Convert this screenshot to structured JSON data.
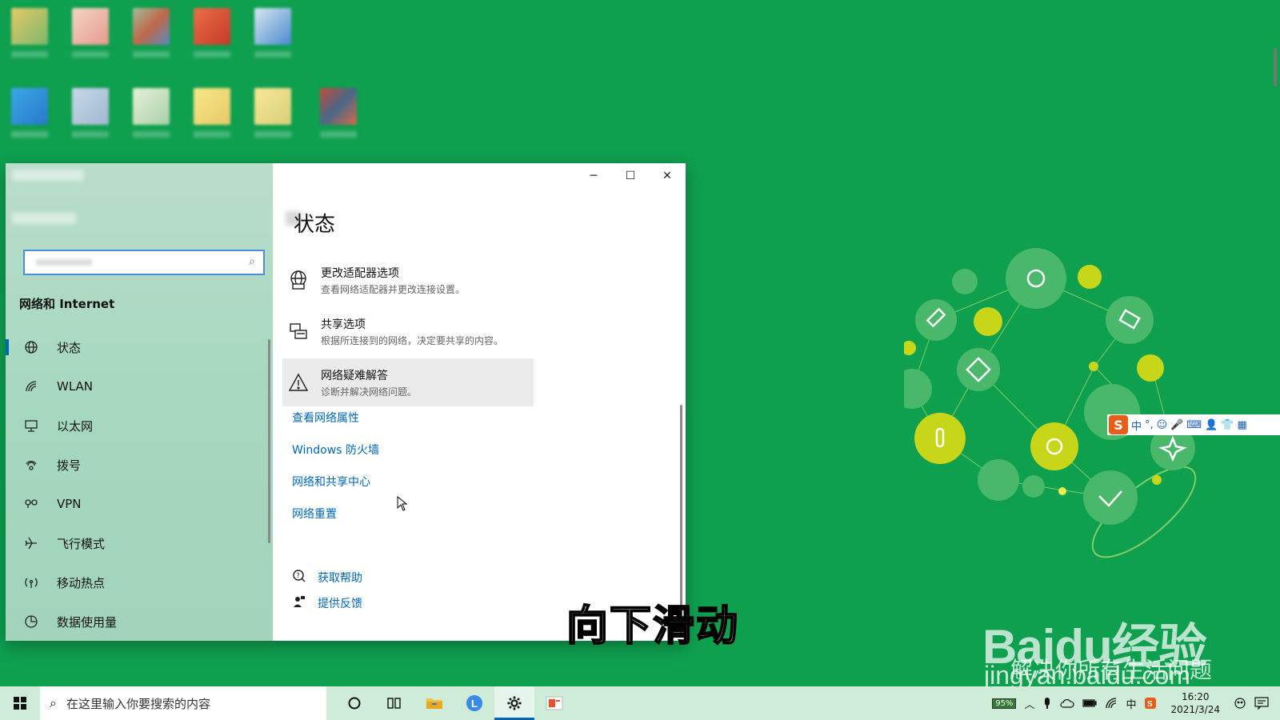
{
  "window": {
    "controls": {
      "minimize": "─",
      "maximize": "☐",
      "close": "✕"
    }
  },
  "sidebar": {
    "section_title": "网络和 Internet",
    "items": [
      {
        "label": "状态",
        "icon": "globe-icon",
        "glyph": "◍"
      },
      {
        "label": "WLAN",
        "icon": "wifi-icon",
        "glyph": "◜"
      },
      {
        "label": "以太网",
        "icon": "ethernet-icon",
        "glyph": "▭"
      },
      {
        "label": "拨号",
        "icon": "dialup-icon",
        "glyph": "☎"
      },
      {
        "label": "VPN",
        "icon": "vpn-icon",
        "glyph": "⚭"
      },
      {
        "label": "飞行模式",
        "icon": "airplane-icon",
        "glyph": "✈"
      },
      {
        "label": "移动热点",
        "icon": "hotspot-icon",
        "glyph": "((·))"
      },
      {
        "label": "数据使用量",
        "icon": "data-usage-icon",
        "glyph": "◔"
      }
    ]
  },
  "main": {
    "title": "状态",
    "options": [
      {
        "title": "更改适配器选项",
        "desc": "查看网络适配器并更改连接设置。",
        "icon": "adapter-icon"
      },
      {
        "title": "共享选项",
        "desc": "根据所连接到的网络，决定要共享的内容。",
        "icon": "sharing-icon"
      },
      {
        "title": "网络疑难解答",
        "desc": "诊断并解决网络问题。",
        "icon": "warning-icon"
      }
    ],
    "links": [
      "查看网络属性",
      "Windows 防火墙",
      "网络和共享中心",
      "网络重置"
    ],
    "help": [
      {
        "label": "获取帮助",
        "icon": "help-icon"
      },
      {
        "label": "提供反馈",
        "icon": "feedback-icon"
      }
    ]
  },
  "subtitle": "向下滑动",
  "watermark": {
    "main": "Baidu经验",
    "sub1": "解决你所有生活问题",
    "sub2": "jingyan.baidu.com"
  },
  "ime": {
    "logo": "S",
    "items": [
      "中",
      "°,",
      "☺",
      "🎤",
      "⌨",
      "👤",
      "👕",
      "▦"
    ]
  },
  "taskbar": {
    "search_placeholder": "在这里输入你要搜索的内容",
    "battery": "95%",
    "ime_indicator": "中",
    "time": "16:20",
    "date": "2021/3/24"
  },
  "colors": {
    "desktop": "#0e9f4f",
    "accent": "#0067b8",
    "sidebar": "#a6d8bf"
  }
}
